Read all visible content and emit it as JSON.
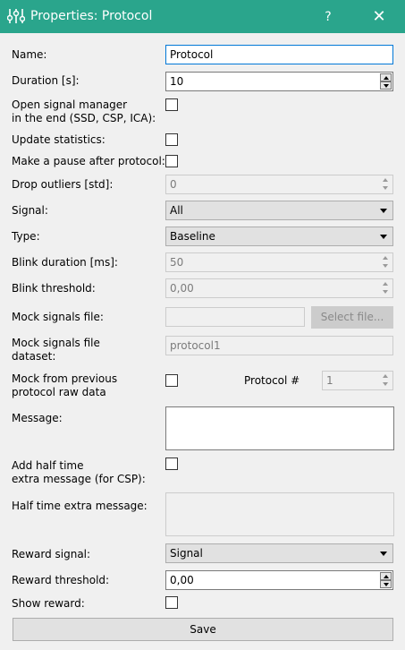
{
  "window": {
    "title": "Properties: Protocol",
    "help_label": "?",
    "close_label": "✕",
    "icon": "sliders-icon",
    "accent": "#2aa58c"
  },
  "name": {
    "label": "Name:",
    "value": "Protocol"
  },
  "duration": {
    "label": "Duration [s]:",
    "value": "10"
  },
  "open_signal_manager": {
    "label_line1": "Open signal manager",
    "label_line2": "in the end (SSD, CSP, ICA):",
    "checked": false
  },
  "update_statistics": {
    "label": "Update statistics:",
    "checked": false
  },
  "pause_after": {
    "label": "Make a pause after protocol:",
    "checked": false
  },
  "drop_outliers": {
    "label": "Drop outliers [std]:",
    "value": "0"
  },
  "signal": {
    "label": "Signal:",
    "value": "All"
  },
  "type": {
    "label": "Type:",
    "value": "Baseline"
  },
  "blink_duration": {
    "label": "Blink duration [ms]:",
    "value": "50"
  },
  "blink_threshold": {
    "label": "Blink threshold:",
    "value": "0,00"
  },
  "mock_signals_file": {
    "label": "Mock signals file:",
    "value": "",
    "button": "Select file..."
  },
  "mock_dataset": {
    "label_line1": "Mock signals file",
    "label_line2": "dataset:",
    "value": "protocol1"
  },
  "mock_previous": {
    "label_line1": "Mock from previous",
    "label_line2": "protocol raw data",
    "checked": false,
    "protocol_label": "Protocol #",
    "protocol_value": "1"
  },
  "message": {
    "label": "Message:",
    "value": ""
  },
  "add_half_time": {
    "label_line1": "Add half time",
    "label_line2": "extra message (for CSP):",
    "checked": false
  },
  "half_time_message": {
    "label": "Half time extra message:",
    "value": ""
  },
  "reward_signal": {
    "label": "Reward signal:",
    "value": "Signal"
  },
  "reward_threshold": {
    "label": "Reward threshold:",
    "value": "0,00"
  },
  "show_reward": {
    "label": "Show reward:",
    "checked": false
  },
  "save_button": "Save"
}
